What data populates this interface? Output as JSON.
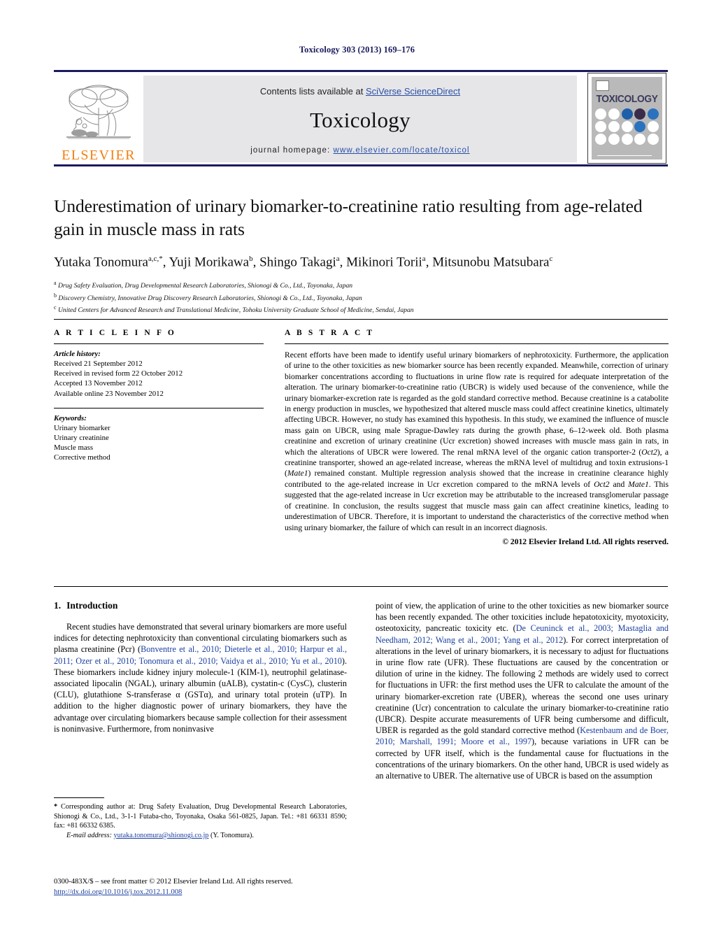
{
  "running_head": "Toxicology 303 (2013) 169–176",
  "masthead": {
    "contents_prefix": "Contents lists available at ",
    "sciencedirect": "SciVerse ScienceDirect",
    "journal_name": "Toxicology",
    "homepage_prefix": "journal homepage: ",
    "homepage_url": "www.elsevier.com/locate/toxicol",
    "publisher_wordmark": "ELSEVIER",
    "publisher_logo_icon": "elsevier-tree-icon",
    "cover_title": "TOXICOLOGY",
    "cover_dot_colors": [
      "#ffffff",
      "#ffffff",
      "#1d5fa8",
      "#3b2d4a",
      "#2a72bd",
      "#ffffff",
      "#ffffff",
      "#ffffff",
      "#2a72bd",
      "#ffffff",
      "#ffffff",
      "#ffffff",
      "#ffffff",
      "#ffffff",
      "#ffffff"
    ],
    "accent_color": "#1a1a5e",
    "link_color": "#2a4fa5",
    "elsevier_orange": "#F08010"
  },
  "title": "Underestimation of urinary biomarker-to-creatinine ratio resulting from age-related gain in muscle mass in rats",
  "authors_html": "Yutaka Tonomura<sup>a,c,</sup><sup>*</sup>, Yuji Morikawa<sup>b</sup>, Shingo Takagi<sup>a</sup>, Mikinori Torii<sup>a</sup>, Mitsunobu Matsubara<sup>c</sup>",
  "affiliations": [
    {
      "marker": "a",
      "text": "Drug Safety Evaluation, Drug Developmental Research Laboratories, Shionogi & Co., Ltd., Toyonaka, Japan"
    },
    {
      "marker": "b",
      "text": "Discovery Chemistry, Innovative Drug Discovery Research Laboratories, Shionogi & Co., Ltd., Toyonaka, Japan"
    },
    {
      "marker": "c",
      "text": "United Centers for Advanced Research and Translational Medicine, Tohoku University Graduate School of Medicine, Sendai, Japan"
    }
  ],
  "article_info": {
    "label": "A R T I C L E     I N F O",
    "history_heading": "Article history:",
    "history": [
      "Received 21 September 2012",
      "Received in revised form 22 October 2012",
      "Accepted 13 November 2012",
      "Available online 23 November 2012"
    ],
    "keywords_heading": "Keywords:",
    "keywords": [
      "Urinary biomarker",
      "Urinary creatinine",
      "Muscle mass",
      "Corrective method"
    ]
  },
  "abstract": {
    "label": "A B S T R A C T",
    "text_html": "Recent efforts have been made to identify useful urinary biomarkers of nephrotoxicity. Furthermore, the application of urine to the other toxicities as new biomarker source has been recently expanded. Meanwhile, correction of urinary biomarker concentrations according to fluctuations in urine flow rate is required for adequate interpretation of the alteration. The urinary biomarker-to-creatinine ratio (UBCR) is widely used because of the convenience, while the urinary biomarker-excretion rate is regarded as the gold standard corrective method. Because creatinine is a catabolite in energy production in muscles, we hypothesized that altered muscle mass could affect creatinine kinetics, ultimately affecting UBCR. However, no study has examined this hypothesis. In this study, we examined the influence of muscle mass gain on UBCR, using male Sprague-Dawley rats during the growth phase, 6–12-week old. Both plasma creatinine and excretion of urinary creatinine (Ucr excretion) showed increases with muscle mass gain in rats, in which the alterations of UBCR were lowered. The renal mRNA level of the organic cation transporter-2 (<i>Oct2</i>), a creatinine transporter, showed an age-related increase, whereas the mRNA level of multidrug and toxin extrusions-1 (<i>Mate1</i>) remained constant. Multiple regression analysis showed that the increase in creatinine clearance highly contributed to the age-related increase in Ucr excretion compared to the mRNA levels of <i>Oct2</i> and <i>Mate1</i>. This suggested that the age-related increase in Ucr excretion may be attributable to the increased transglomerular passage of creatinine. In conclusion, the results suggest that muscle mass gain can affect creatinine kinetics, leading to underestimation of UBCR. Therefore, it is important to understand the characteristics of the corrective method when using urinary biomarker, the failure of which can result in an incorrect diagnosis.",
    "copyright": "© 2012 Elsevier Ireland Ltd. All rights reserved."
  },
  "introduction": {
    "number": "1.",
    "heading": "Introduction",
    "left_paragraph_html": "Recent studies have demonstrated that several urinary biomarkers are more useful indices for detecting nephrotoxicity than conventional circulating biomarkers such as plasma creatinine (Pcr) (<span class=\"cite\">Bonventre et al., 2010; Dieterle et al., 2010; Harpur et al., 2011; Ozer et al., 2010; Tonomura et al., 2010; Vaidya et al., 2010; Yu et al., 2010</span>). These biomarkers include kidney injury molecule-1 (KIM-1), neutrophil gelatinase-associated lipocalin (NGAL), urinary albumin (uALB), cystatin-c (CysC), clusterin (CLU), glutathione S-transferase α (GSTα), and urinary total protein (uTP). In addition to the higher diagnostic power of urinary biomarkers, they have the advantage over circulating biomarkers because sample collection for their assessment is noninvasive. Furthermore, from noninvasive",
    "right_paragraph_html": "point of view, the application of urine to the other toxicities as new biomarker source has been recently expanded. The other toxicities include hepatotoxicity, myotoxicity, osteotoxicity, pancreatic toxicity etc. (<span class=\"cite\">De Ceuninck et al., 2003; Mastaglia and Needham, 2012; Wang et al., 2001; Yang et al., 2012</span>). For correct interpretation of alterations in the level of urinary biomarkers, it is necessary to adjust for fluctuations in urine flow rate (UFR). These fluctuations are caused by the concentration or dilution of urine in the kidney. The following 2 methods are widely used to correct for fluctuations in UFR: the first method uses the UFR to calculate the amount of the urinary biomarker-excretion rate (UBER), whereas the second one uses urinary creatinine (Ucr) concentration to calculate the urinary biomarker-to-creatinine ratio (UBCR). Despite accurate measurements of UFR being cumbersome and difficult, UBER is regarded as the gold standard corrective method (<span class=\"cite\">Kestenbaum and de Boer, 2010; Marshall, 1991; Moore et al., 1997</span>), because variations in UFR can be corrected by UFR itself, which is the fundamental cause for fluctuations in the concentrations of the urinary biomarkers. On the other hand, UBCR is used widely as an alternative to UBER. The alternative use of UBCR is based on the assumption"
  },
  "footnote": {
    "corresponding_html": "<b>*</b> Corresponding author at: Drug Safety Evaluation, Drug Developmental Research Laboratories, Shionogi &amp; Co., Ltd., 3-1-1 Futaba-cho, Toyonaka, Osaka 561-0825, Japan. Tel.: +81 66331 8590; fax: +81 66332 6385.",
    "email_label": "E-mail address:",
    "email": "yutaka.tonomura@shionogi.co.jp",
    "email_owner": "(Y. Tonomura)."
  },
  "imprint": {
    "issn_line": "0300-483X/$ – see front matter © 2012 Elsevier Ireland Ltd. All rights reserved.",
    "doi": "http://dx.doi.org/10.1016/j.tox.2012.11.008"
  }
}
